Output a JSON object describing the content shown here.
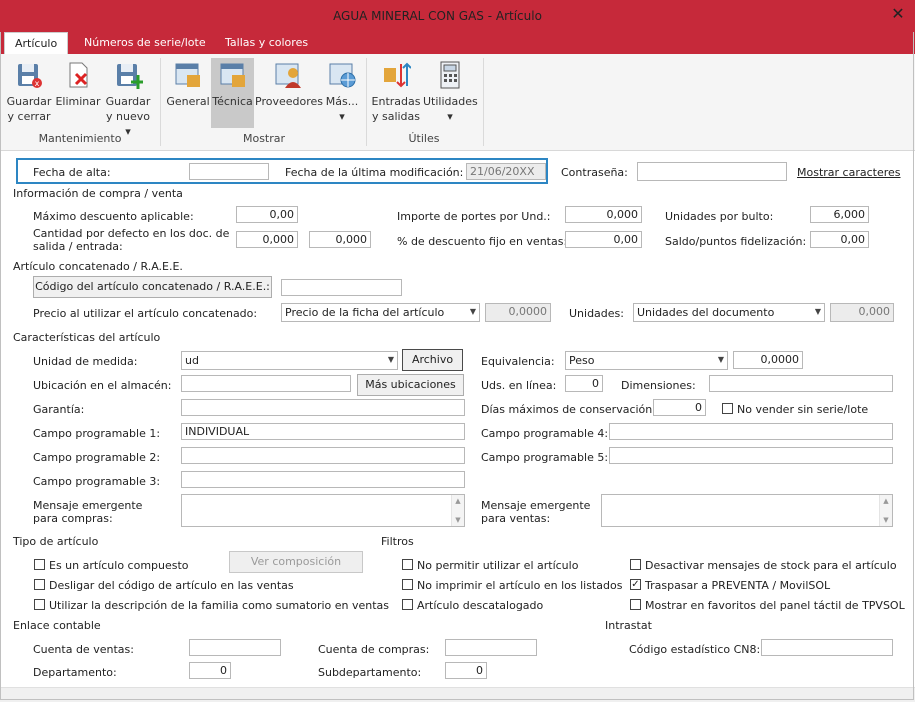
{
  "window": {
    "title": "AGUA MINERAL CON GAS - Artículo",
    "close": "✕"
  },
  "tabs": [
    {
      "label": "Artículo"
    },
    {
      "label": "Números de serie/lote"
    },
    {
      "label": "Tallas y colores"
    }
  ],
  "ribbon": {
    "groups": {
      "mantenimiento": "Mantenimiento",
      "mostrar": "Mostrar",
      "utiles": "Útiles"
    },
    "buttons": {
      "guardar_cerrar": {
        "line1": "Guardar",
        "line2": "y cerrar"
      },
      "eliminar": {
        "line1": "Eliminar"
      },
      "guardar_nuevo": {
        "line1": "Guardar",
        "line2": "y nuevo ▾"
      },
      "general": {
        "line1": "General"
      },
      "tecnica": {
        "line1": "Técnica"
      },
      "proveedores": {
        "line1": "Proveedores"
      },
      "mas": {
        "line1": "Más...",
        "line2": "▾"
      },
      "entradas": {
        "line1": "Entradas",
        "line2": "y salidas"
      },
      "utilidades": {
        "line1": "Utilidades",
        "line2": "▾"
      }
    }
  },
  "top": {
    "fecha_alta_label": "Fecha de alta:",
    "fecha_alta_value": "",
    "fecha_mod_label": "Fecha de la última modificación:",
    "fecha_mod_value": "21/06/20XX",
    "contrasena_label": "Contraseña:",
    "contrasena_value": "",
    "mostrar_caracteres": "Mostrar caracteres"
  },
  "compra": {
    "title": "Información de compra / venta",
    "max_desc_label": "Máximo descuento aplicable:",
    "max_desc_value": "0,00",
    "cantidad_label_1": "Cantidad por defecto en los doc. de",
    "cantidad_label_2": "salida / entrada:",
    "cantidad_salida": "0,000",
    "slash": "/",
    "cantidad_entrada": "0,000",
    "portes_label": "Importe de portes por Und.:",
    "portes_value": "0,000",
    "desc_fijo_label": "% de descuento fijo en ventas:",
    "desc_fijo_value": "0,00",
    "unid_bulto_label": "Unidades por bulto:",
    "unid_bulto_value": "6,000",
    "saldo_label": "Saldo/puntos fidelización:",
    "saldo_value": "0,00"
  },
  "concatenado": {
    "title": "Artículo concatenado / R.A.E.E.",
    "btn_codigo": "Código del artículo concatenado / R.A.E.E.:",
    "codigo_value": "",
    "precio_label": "Precio al utilizar el artículo concatenado:",
    "precio_select": "Precio de la ficha del artículo",
    "precio_value": "0,0000",
    "unidades_label": "Unidades:",
    "unidades_select": "Unidades del documento",
    "unidades_value": "0,000"
  },
  "caracteristicas": {
    "title": "Características del artículo",
    "unidad_label": "Unidad de medida:",
    "unidad_value": "ud",
    "archivo_btn": "Archivo",
    "ubicacion_label": "Ubicación en el almacén:",
    "ubicacion_value": "",
    "mas_ubicaciones_btn": "Más ubicaciones",
    "garantia_label": "Garantía:",
    "garantia_value": "",
    "cp1_label": "Campo programable 1:",
    "cp1_value": "INDIVIDUAL",
    "cp2_label": "Campo programable 2:",
    "cp2_value": "",
    "cp3_label": "Campo programable 3:",
    "cp3_value": "",
    "msg_compras_label_1": "Mensaje emergente",
    "msg_compras_label_2": "para compras:",
    "equivalencia_label": "Equivalencia:",
    "equivalencia_select": "Peso",
    "equivalencia_value": "0,0000",
    "uds_linea_label": "Uds. en línea:",
    "uds_linea_value": "0",
    "dimensiones_label": "Dimensiones:",
    "dimensiones_value": "",
    "dias_label": "Días máximos de conservación:",
    "dias_value": "0",
    "no_vender_label": "No vender sin serie/lote",
    "cp4_label": "Campo programable 4:",
    "cp4_value": "",
    "cp5_label": "Campo programable 5:",
    "cp5_value": "",
    "msg_ventas_label_1": "Mensaje emergente",
    "msg_ventas_label_2": "para ventas:"
  },
  "tipo": {
    "title": "Tipo de artículo",
    "compuesto": "Es un artículo compuesto",
    "ver_composicion": "Ver composición",
    "desligar": "Desligar del código de artículo en las ventas",
    "utilizar_desc": "Utilizar la descripción de la familia como sumatorio en ventas"
  },
  "filtros": {
    "title": "Filtros",
    "no_permitir": "No permitir utilizar el artículo",
    "no_imprimir": "No imprimir el artículo en los listados",
    "descatalogado": "Artículo descatalogado",
    "desactivar_stock": "Desactivar mensajes de stock para el artículo",
    "traspasar": "Traspasar a PREVENTA / MovilSOL",
    "traspasar_checked": "✓",
    "mostrar_favoritos": "Mostrar en favoritos del panel táctil de TPVSOL"
  },
  "enlace": {
    "title": "Enlace contable",
    "cuenta_ventas_label": "Cuenta de ventas:",
    "cuenta_ventas_value": "",
    "cuenta_compras_label": "Cuenta de compras:",
    "cuenta_compras_value": "",
    "departamento_label": "Departamento:",
    "departamento_value": "0",
    "subdepartamento_label": "Subdepartamento:",
    "subdepartamento_value": "0"
  },
  "intrastat": {
    "title": "Intrastat",
    "cn8_label": "Código estadístico CN8:",
    "cn8_value": ""
  },
  "colors": {
    "brand": "#c6293a",
    "highlight": "#2d86c3"
  }
}
